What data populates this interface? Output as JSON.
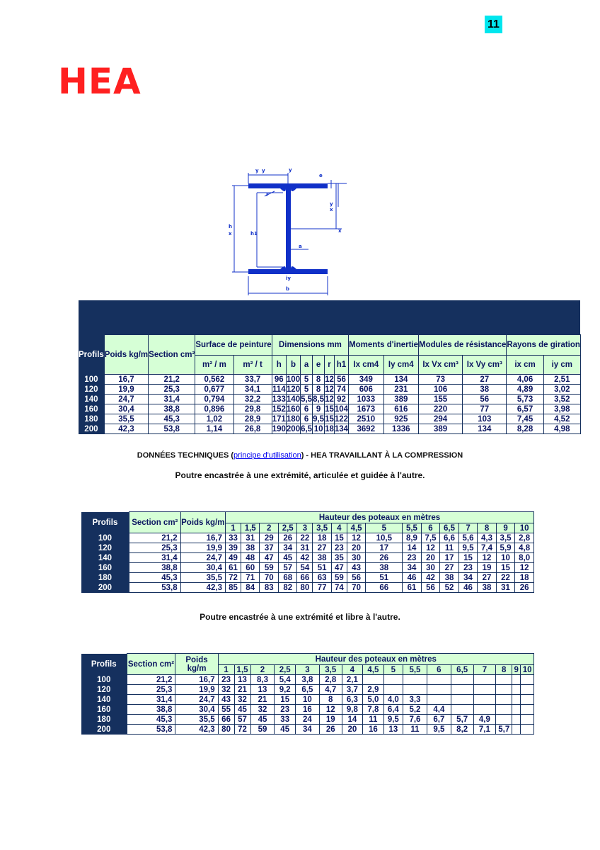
{
  "page_number": "11",
  "title": "HEA",
  "diagram": {
    "labels": [
      "y",
      "y",
      "e",
      "x",
      "h",
      "x",
      "h1",
      "r",
      "a",
      "iy",
      "b"
    ]
  },
  "main_table": {
    "headers": {
      "profils": "Profils",
      "poids": "Poids kg/m",
      "section": "Section cm²",
      "surface": "Surface de peinture",
      "surface_sub": [
        "m² / m",
        "m² / t"
      ],
      "dimensions": "Dimensions mm",
      "dimensions_sub": [
        "h",
        "b",
        "a",
        "e",
        "r",
        "h1"
      ],
      "moments": "Moments d'inertie",
      "moments_sub": [
        "Ix cm4",
        "Iy cm4"
      ],
      "modules": "Modules de résistance",
      "modules_sub": [
        "Ix Vx cm³",
        "Ix Vy cm³"
      ],
      "rayons": "Rayons de giration",
      "rayons_sub": [
        "ix cm",
        "iy cm"
      ]
    },
    "rows": [
      [
        "100",
        "16,7",
        "21,2",
        "0,562",
        "33,7",
        "96",
        "100",
        "5",
        "8",
        "12",
        "56",
        "349",
        "134",
        "73",
        "27",
        "4,06",
        "2,51"
      ],
      [
        "120",
        "19,9",
        "25,3",
        "0,677",
        "34,1",
        "114",
        "120",
        "5",
        "8",
        "12",
        "74",
        "606",
        "231",
        "106",
        "38",
        "4,89",
        "3,02"
      ],
      [
        "140",
        "24,7",
        "31,4",
        "0,794",
        "32,2",
        "133",
        "140",
        "5,5",
        "8,5",
        "12",
        "92",
        "1033",
        "389",
        "155",
        "56",
        "5,73",
        "3,52"
      ],
      [
        "160",
        "30,4",
        "38,8",
        "0,896",
        "29,8",
        "152",
        "160",
        "6",
        "9",
        "15",
        "104",
        "1673",
        "616",
        "220",
        "77",
        "6,57",
        "3,98"
      ],
      [
        "180",
        "35,5",
        "45,3",
        "1,02",
        "28,9",
        "171",
        "180",
        "6",
        "9,5",
        "15",
        "122",
        "2510",
        "925",
        "294",
        "103",
        "7,45",
        "4,52"
      ],
      [
        "200",
        "42,3",
        "53,8",
        "1,14",
        "26,8",
        "190",
        "200",
        "6,5",
        "10",
        "18",
        "134",
        "3692",
        "1336",
        "389",
        "134",
        "8,28",
        "4,98"
      ]
    ]
  },
  "tech_line": {
    "prefix": "DONNÉES TECHNIQUES (",
    "link": "principe d'utilisation",
    "suffix": ") - HEA TRAVAILLANT À LA COMPRESSION"
  },
  "subtitle1": "Poutre encastrée à une extrémité, articulée et guidée à l'autre.",
  "subtitle2": "Poutre encastrée à une extrémité et libre à l'autre.",
  "height_tables_headers": {
    "profils": "Profils",
    "section": "Section cm²",
    "poids": "Poids kg/m",
    "hauteur": "Hauteur des poteaux en mètres",
    "heights": [
      "1",
      "1,5",
      "2",
      "2,5",
      "3",
      "3,5",
      "4",
      "4,5",
      "5",
      "5,5",
      "6",
      "6,5",
      "7",
      "8",
      "9",
      "10"
    ]
  },
  "table2": [
    [
      "100",
      "21,2",
      "16,7",
      "33",
      "31",
      "29",
      "26",
      "22",
      "18",
      "15",
      "12",
      "10,5",
      "8,9",
      "7,5",
      "6,6",
      "5,6",
      "4,3",
      "3,5",
      "2,8"
    ],
    [
      "120",
      "25,3",
      "19,9",
      "39",
      "38",
      "37",
      "34",
      "31",
      "27",
      "23",
      "20",
      "17",
      "14",
      "12",
      "11",
      "9,5",
      "7,4",
      "5,9",
      "4,8"
    ],
    [
      "140",
      "31,4",
      "24,7",
      "49",
      "48",
      "47",
      "45",
      "42",
      "38",
      "35",
      "30",
      "26",
      "23",
      "20",
      "17",
      "15",
      "12",
      "10",
      "8,0"
    ],
    [
      "160",
      "38,8",
      "30,4",
      "61",
      "60",
      "59",
      "57",
      "54",
      "51",
      "47",
      "43",
      "38",
      "34",
      "30",
      "27",
      "23",
      "19",
      "15",
      "12"
    ],
    [
      "180",
      "45,3",
      "35,5",
      "72",
      "71",
      "70",
      "68",
      "66",
      "63",
      "59",
      "56",
      "51",
      "46",
      "42",
      "38",
      "34",
      "27",
      "22",
      "18"
    ],
    [
      "200",
      "53,8",
      "42,3",
      "85",
      "84",
      "83",
      "82",
      "80",
      "77",
      "74",
      "70",
      "66",
      "61",
      "56",
      "52",
      "46",
      "38",
      "31",
      "26"
    ]
  ],
  "table3": [
    [
      "100",
      "21,2",
      "16,7",
      "23",
      "13",
      "8,3",
      "5,4",
      "3,8",
      "2,8",
      "2,1",
      "",
      "",
      "",
      "",
      "",
      "",
      "",
      "",
      ""
    ],
    [
      "120",
      "25,3",
      "19,9",
      "32",
      "21",
      "13",
      "9,2",
      "6,5",
      "4,7",
      "3,7",
      "2,9",
      "",
      "",
      "",
      "",
      "",
      "",
      "",
      ""
    ],
    [
      "140",
      "31,4",
      "24,7",
      "43",
      "32",
      "21",
      "15",
      "10",
      "8",
      "6,3",
      "5,0",
      "4,0",
      "3,3",
      "",
      "",
      "",
      "",
      "",
      ""
    ],
    [
      "160",
      "38,8",
      "30,4",
      "55",
      "45",
      "32",
      "23",
      "16",
      "12",
      "9,8",
      "7,8",
      "6,4",
      "5,2",
      "4,4",
      "",
      "",
      "",
      "",
      ""
    ],
    [
      "180",
      "45,3",
      "35,5",
      "66",
      "57",
      "45",
      "33",
      "24",
      "19",
      "14",
      "11",
      "9,5",
      "7,6",
      "6,7",
      "5,7",
      "4,9",
      "",
      "",
      ""
    ],
    [
      "200",
      "53,8",
      "42,3",
      "80",
      "72",
      "59",
      "45",
      "34",
      "26",
      "20",
      "16",
      "13",
      "11",
      "9,5",
      "8,2",
      "7,1",
      "5,7",
      "",
      ""
    ]
  ]
}
